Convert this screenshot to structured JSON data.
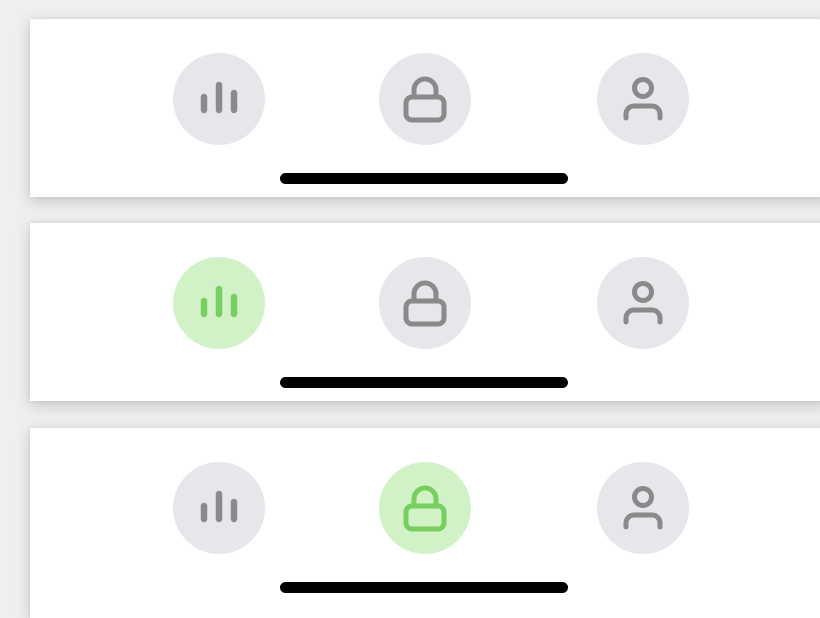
{
  "colors": {
    "background": "#efeff1",
    "bar": "#ffffff",
    "tab_default_bg": "#e6e7eb",
    "tab_active_bg": "#d0f2c6",
    "icon_default": "#8a8a8a",
    "icon_active": "#78cf5f",
    "home_indicator": "#000000"
  },
  "tabbars": [
    {
      "active_tab": "none",
      "tabs": [
        {
          "icon": "bar-chart-icon",
          "active": false
        },
        {
          "icon": "lock-icon",
          "active": false
        },
        {
          "icon": "user-icon",
          "active": false
        }
      ]
    },
    {
      "active_tab": "stats",
      "tabs": [
        {
          "icon": "bar-chart-icon",
          "active": true
        },
        {
          "icon": "lock-icon",
          "active": false
        },
        {
          "icon": "user-icon",
          "active": false
        }
      ]
    },
    {
      "active_tab": "lock",
      "tabs": [
        {
          "icon": "bar-chart-icon",
          "active": false
        },
        {
          "icon": "lock-icon",
          "active": true
        },
        {
          "icon": "user-icon",
          "active": false
        }
      ]
    }
  ]
}
